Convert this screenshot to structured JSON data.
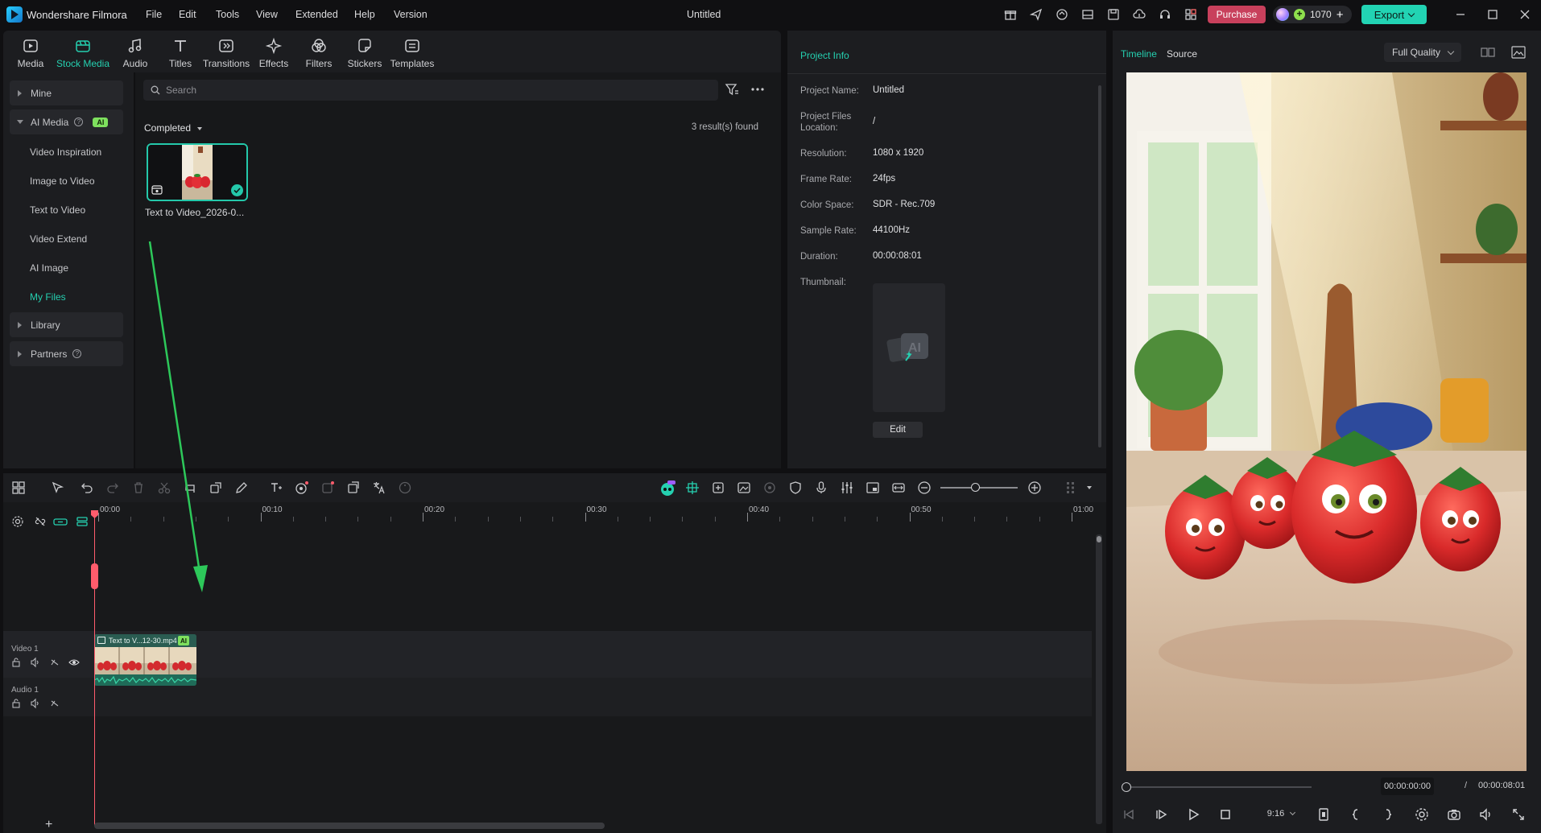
{
  "app": {
    "name": "Wondershare Filmora",
    "window_title": "Untitled"
  },
  "menu": [
    "File",
    "Edit",
    "Tools",
    "View",
    "Extended",
    "Help",
    "Version"
  ],
  "titlebar": {
    "purchase_label": "Purchase",
    "credits": "1070",
    "export_label": "Export"
  },
  "media_tabs": [
    {
      "label": "Media",
      "icon": "media-icon"
    },
    {
      "label": "Stock Media",
      "icon": "stock-media-icon",
      "active": true
    },
    {
      "label": "Audio",
      "icon": "audio-icon"
    },
    {
      "label": "Titles",
      "icon": "titles-icon"
    },
    {
      "label": "Transitions",
      "icon": "transitions-icon"
    },
    {
      "label": "Effects",
      "icon": "effects-icon"
    },
    {
      "label": "Filters",
      "icon": "filters-icon"
    },
    {
      "label": "Stickers",
      "icon": "stickers-icon"
    },
    {
      "label": "Templates",
      "icon": "templates-icon"
    }
  ],
  "sidebar": {
    "mine": "Mine",
    "ai_media": "AI Media",
    "ai_badge": "AI",
    "ai_items": [
      "Video Inspiration",
      "Image to Video",
      "Text to Video",
      "Video Extend",
      "AI Image",
      "My Files"
    ],
    "active_item": "My Files",
    "library": "Library",
    "partners": "Partners"
  },
  "browser": {
    "search_placeholder": "Search",
    "filter_label": "Completed",
    "results": "3 result(s) found",
    "item_caption": "Text to Video_2026-0..."
  },
  "project_info": {
    "title": "Project Info",
    "rows": [
      {
        "label": "Project Name:",
        "value": "Untitled"
      },
      {
        "label": "Project Files Location:",
        "value": "/"
      },
      {
        "label": "Resolution:",
        "value": "1080 x 1920"
      },
      {
        "label": "Frame Rate:",
        "value": "24fps"
      },
      {
        "label": "Color Space:",
        "value": "SDR - Rec.709"
      },
      {
        "label": "Sample Rate:",
        "value": "44100Hz"
      },
      {
        "label": "Duration:",
        "value": "00:00:08:01"
      },
      {
        "label": "Thumbnail:",
        "value": ""
      }
    ],
    "edit_label": "Edit"
  },
  "player": {
    "tabs": [
      "Timeline",
      "Source"
    ],
    "quality": "Full Quality",
    "current_time": "00:00:00:00",
    "separator": "/",
    "total_time": "00:00:08:01",
    "aspect": "9:16",
    "progress": 0
  },
  "timeline": {
    "ruler_labels": [
      "00:00",
      "00:10",
      "00:20",
      "00:30",
      "00:40",
      "00:50",
      "01:00"
    ],
    "tracks": [
      {
        "name": "Video 1"
      },
      {
        "name": "Audio 1"
      }
    ],
    "clip_label": "Text to V...12-30.mp4",
    "clip_badge": "AI",
    "add_track": "+"
  },
  "colors": {
    "accent": "#25d0b0",
    "purchase": "#c8405c",
    "playhead": "#ff5c6c",
    "drag_arrow": "#2dc85a"
  }
}
